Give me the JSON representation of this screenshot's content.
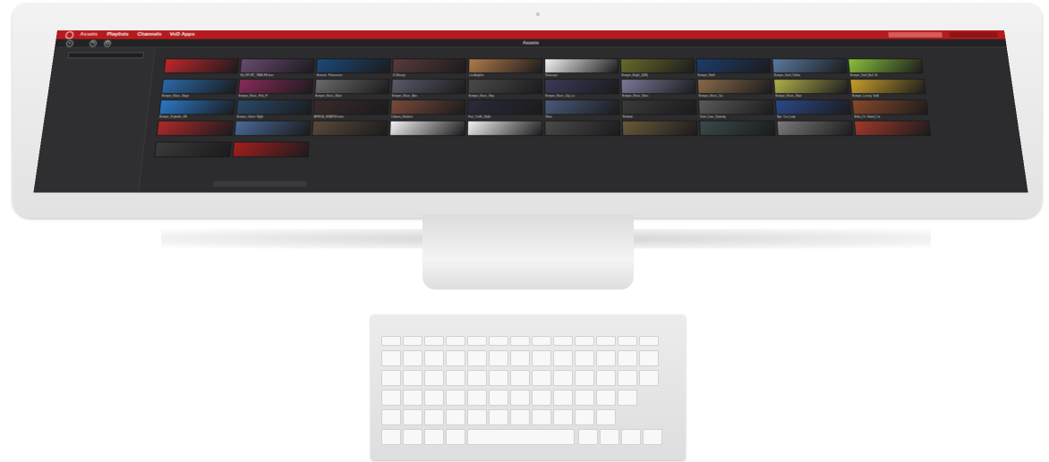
{
  "app": {
    "nav": [
      "Assets",
      "Playlists",
      "Channels",
      "VoD Apps"
    ],
    "toolbar_title": "Assets",
    "colors": {
      "brand": "#b51b1e",
      "screen_bg": "#2c2c2e"
    }
  },
  "grid": {
    "thumbnails": [
      {
        "label": "",
        "color": "#c0262a"
      },
      {
        "label": "Ed_SPORT_TRAILER.mov",
        "color": "#6a4a70"
      },
      {
        "label": "Hatsune_Promo.mov",
        "color": "#1a4a7a"
      },
      {
        "label": "DJ Beauty",
        "color": "#5a3a3a"
      },
      {
        "label": "Los Angeles",
        "color": "#b07a4a"
      },
      {
        "label": "Seascape",
        "color": "#f2f2f2"
      },
      {
        "label": "Bumper_Bright_(16B)",
        "color": "#6a6a2a"
      },
      {
        "label": "Bumper_Hotel",
        "color": "#1c3c6c"
      },
      {
        "label": "Bumper_Swirl_Yellow",
        "color": "#5a7aa0"
      },
      {
        "label": "Bumper_Swirl_Ball_Gr",
        "color": "#8ac23a"
      },
      {
        "label": "Bumper_Music_Stage",
        "color": "#2a6aaa"
      },
      {
        "label": "Bumper_Music_Pink_Fl",
        "color": "#8a2a5a"
      },
      {
        "label": "Bumper_Music_Wave",
        "color": "#6a6a6a"
      },
      {
        "label": "Bumper_Music_Bars",
        "color": "#5a5a6a"
      },
      {
        "label": "Bumper_Music_Strip",
        "color": "#4a4a4a"
      },
      {
        "label": "Bumper_Music_City_Lo",
        "color": "#3a3a5a"
      },
      {
        "label": "Bumper_Music_Stars",
        "color": "#7a7a9a"
      },
      {
        "label": "Bumper_Music_Car",
        "color": "#8a6a4a"
      },
      {
        "label": "Bumper_Music_Glow",
        "color": "#b0b04a"
      },
      {
        "label": "Bumper_Luxury_Gold",
        "color": "#c8a02a"
      },
      {
        "label": "Bumper_Exploder_Wh",
        "color": "#2a7ac8"
      },
      {
        "label": "Bumper_Urban_Night",
        "color": "#2a4a6a"
      },
      {
        "label": "AFRICA_BOATING.mov",
        "color": "#3a2a2a"
      },
      {
        "label": "Cabana_Notation",
        "color": "#7a4a3a"
      },
      {
        "label": "Fast_Traffic_Night",
        "color": "#2a2a3a"
      },
      {
        "label": "Skies",
        "color": "#4a5a7a"
      },
      {
        "label": "Rotation",
        "color": "#3a3a3a"
      },
      {
        "label": "Suite_Door_Opening",
        "color": "#5a5a5a"
      },
      {
        "label": "Bye_Car_Loop",
        "color": "#2a4a8a"
      },
      {
        "label": "Bella_On_Stand_Cut",
        "color": "#8a4a2a"
      },
      {
        "label": "",
        "color": "#b02a2a"
      },
      {
        "label": "",
        "color": "#4a6a9a"
      },
      {
        "label": "",
        "color": "#5a4a3a"
      },
      {
        "label": "",
        "color": "#f2f2f2"
      },
      {
        "label": "",
        "color": "#f2f2f2"
      },
      {
        "label": "",
        "color": "#4a4a4a"
      },
      {
        "label": "",
        "color": "#6a5a3a"
      },
      {
        "label": "",
        "color": "#3a4a4a"
      },
      {
        "label": "",
        "color": "#7a7a7a"
      },
      {
        "label": "",
        "color": "#a03a2a"
      },
      {
        "label": "",
        "color": "#3a3a3a"
      },
      {
        "label": "",
        "color": "#a81e1e"
      }
    ]
  }
}
